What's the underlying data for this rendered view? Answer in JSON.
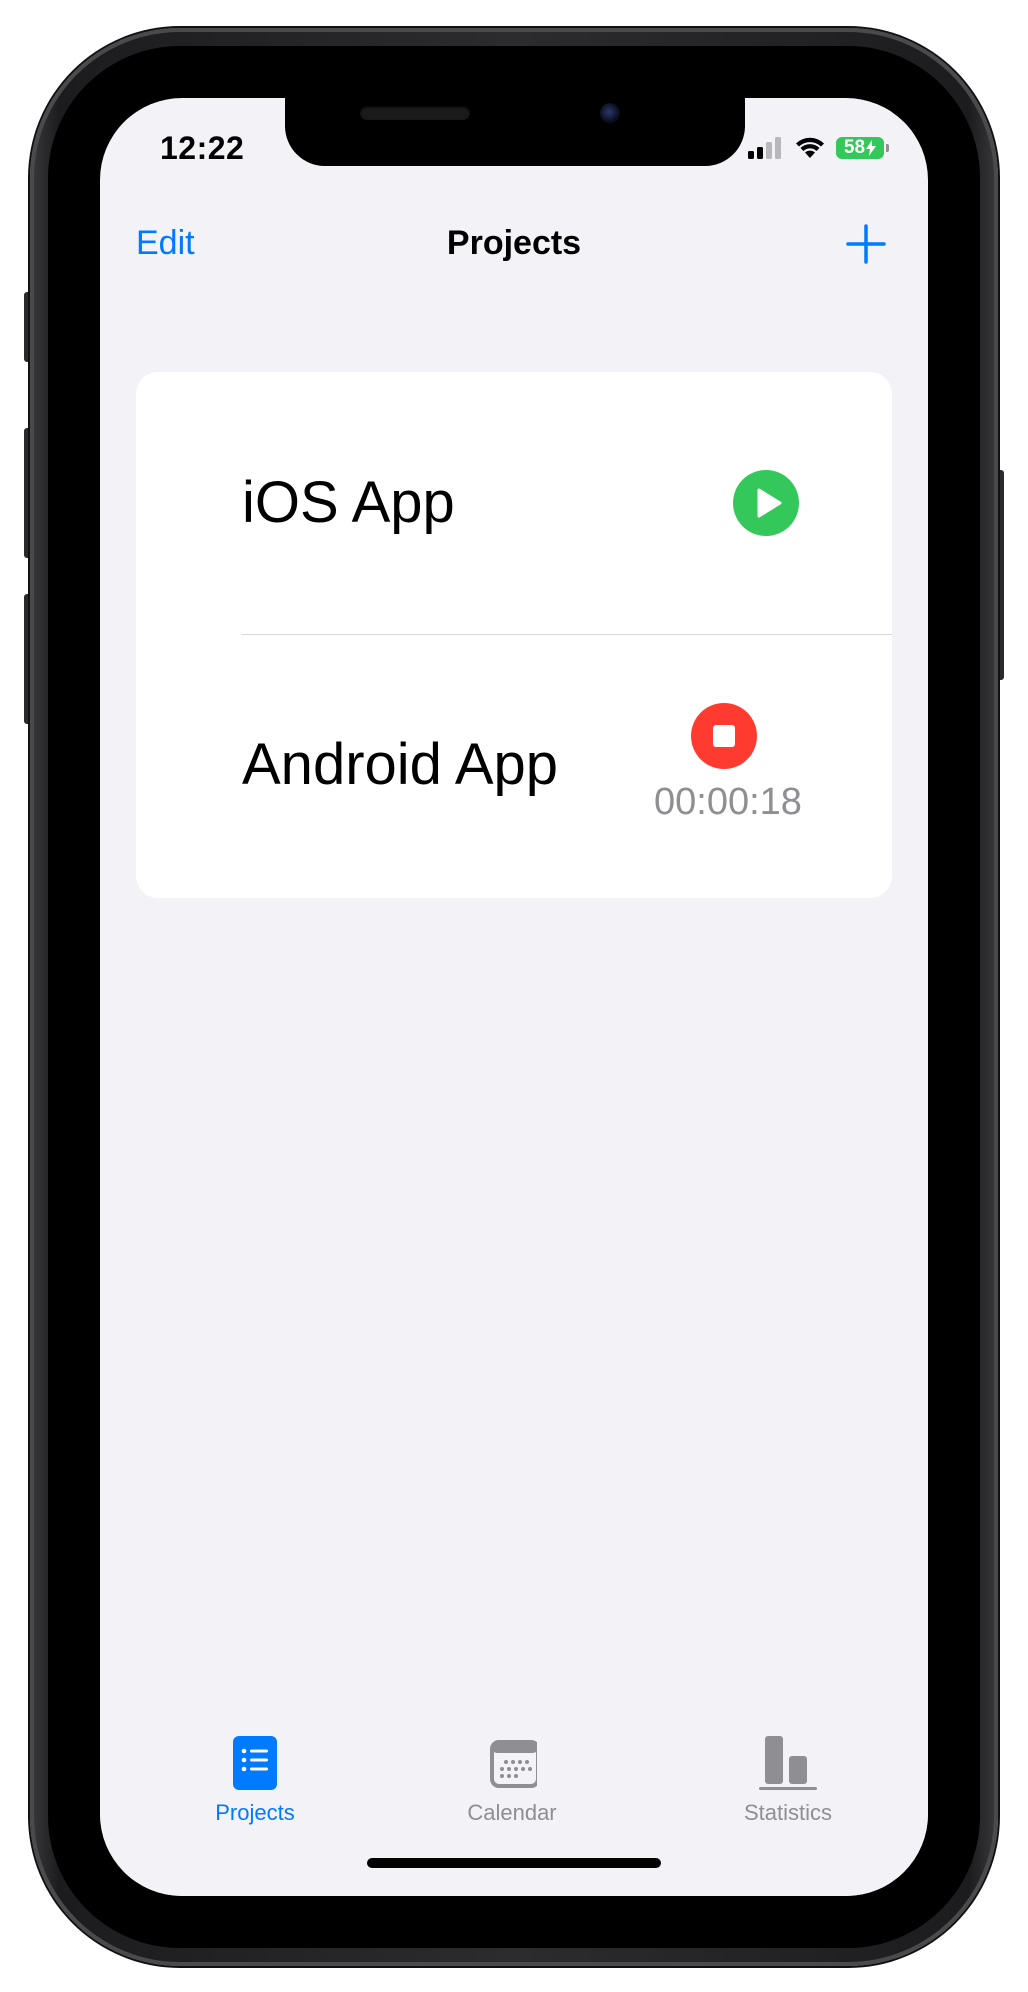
{
  "status_bar": {
    "time": "12:22",
    "battery_level": "58",
    "signal_icon": "cellular-signal-icon",
    "wifi_icon": "wifi-icon",
    "battery_color": "#34c759"
  },
  "nav": {
    "edit_label": "Edit",
    "title": "Projects",
    "add_icon": "plus-icon",
    "accent_color": "#007aff"
  },
  "projects": [
    {
      "name": "iOS App",
      "state": "stopped",
      "action_icon": "play-icon",
      "action_color": "#34c759"
    },
    {
      "name": "Android App",
      "state": "running",
      "action_icon": "stop-icon",
      "action_color": "#ff3b30",
      "elapsed": "00:00:18"
    }
  ],
  "tabbar": {
    "tabs": [
      {
        "label": "Projects",
        "icon": "list-icon",
        "active": true
      },
      {
        "label": "Calendar",
        "icon": "calendar-icon",
        "active": false
      },
      {
        "label": "Statistics",
        "icon": "bar-chart-icon",
        "active": false
      }
    ],
    "active_color": "#007aff",
    "inactive_color": "#8e8e93"
  }
}
